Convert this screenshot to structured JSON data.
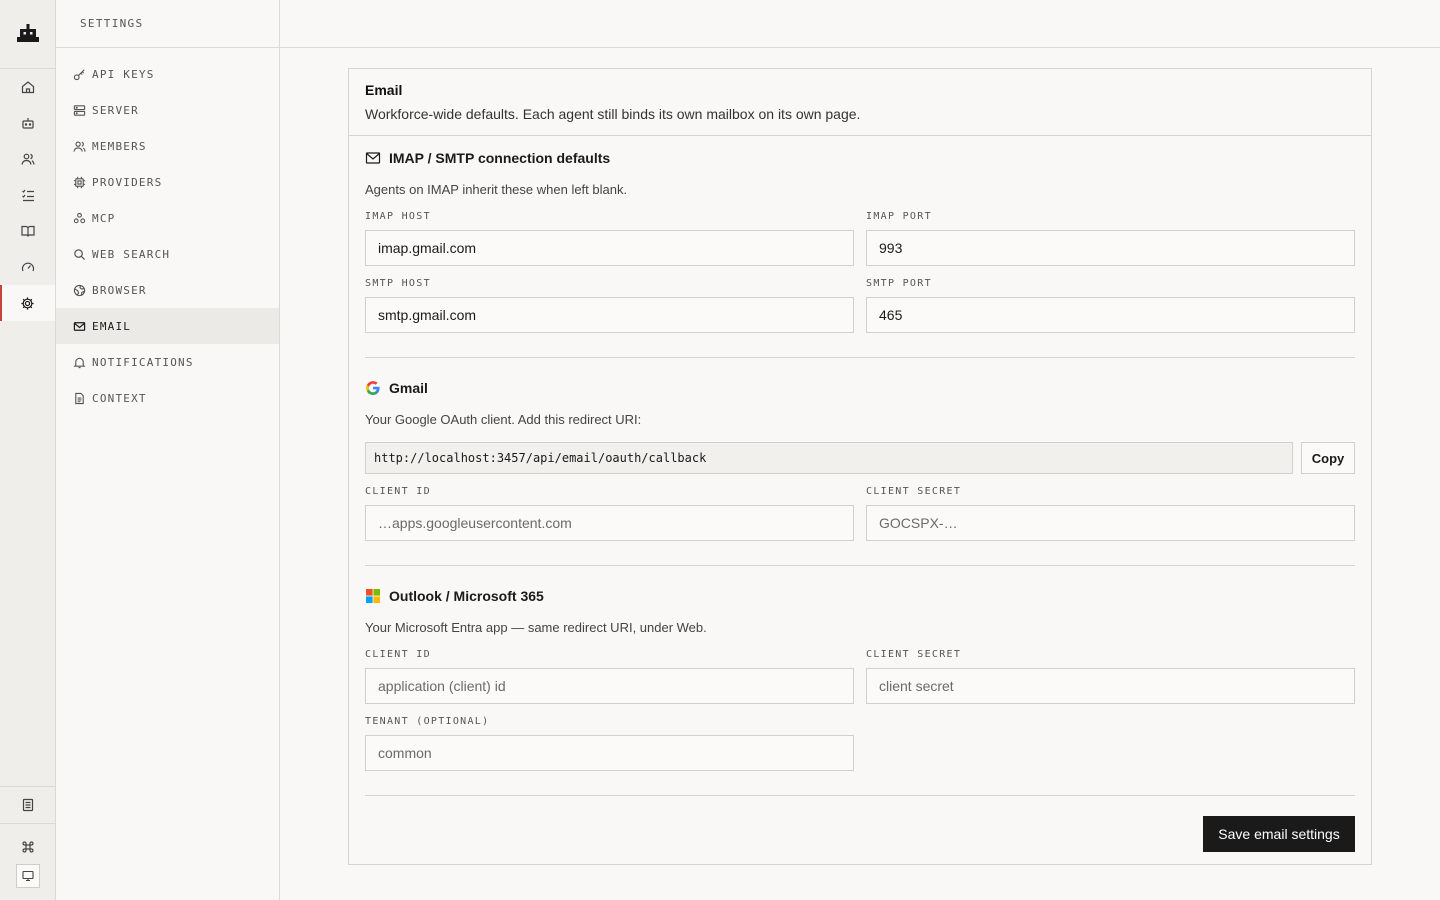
{
  "header": {
    "title": "SETTINGS"
  },
  "settings_nav": [
    {
      "label": "API KEYS",
      "icon": "key-icon"
    },
    {
      "label": "SERVER",
      "icon": "server-icon"
    },
    {
      "label": "MEMBERS",
      "icon": "users-icon"
    },
    {
      "label": "PROVIDERS",
      "icon": "chip-icon"
    },
    {
      "label": "MCP",
      "icon": "mcp-icon"
    },
    {
      "label": "WEB SEARCH",
      "icon": "search-icon"
    },
    {
      "label": "BROWSER",
      "icon": "globe-icon"
    },
    {
      "label": "EMAIL",
      "icon": "mail-icon",
      "active": true
    },
    {
      "label": "NOTIFICATIONS",
      "icon": "bell-icon"
    },
    {
      "label": "CONTEXT",
      "icon": "document-icon"
    }
  ],
  "rail": [
    "home-icon",
    "agent-icon",
    "users-icon",
    "tasks-icon",
    "book-icon",
    "gauge-icon",
    "settings-icon",
    "notes-icon",
    "command-icon",
    "monitor-icon"
  ],
  "card": {
    "title": "Email",
    "description": "Workforce-wide defaults. Each agent still binds its own mailbox on its own page."
  },
  "imap": {
    "title": "IMAP / SMTP connection defaults",
    "note": "Agents on IMAP inherit these when left blank.",
    "imap_host_label": "IMAP HOST",
    "imap_host": "imap.gmail.com",
    "imap_port_label": "IMAP PORT",
    "imap_port": "993",
    "smtp_host_label": "SMTP HOST",
    "smtp_host": "smtp.gmail.com",
    "smtp_port_label": "SMTP PORT",
    "smtp_port": "465"
  },
  "gmail": {
    "title": "Gmail",
    "note": "Your Google OAuth client. Add this redirect URI:",
    "redirect_uri": "http://localhost:3457/api/email/oauth/callback",
    "copy_label": "Copy",
    "client_id_label": "CLIENT ID",
    "client_id_placeholder": "…apps.googleusercontent.com",
    "client_secret_label": "CLIENT SECRET",
    "client_secret_placeholder": "GOCSPX-…"
  },
  "outlook": {
    "title": "Outlook / Microsoft 365",
    "note": "Your Microsoft Entra app — same redirect URI, under Web.",
    "client_id_label": "CLIENT ID",
    "client_id_placeholder": "application (client) id",
    "client_secret_label": "CLIENT SECRET",
    "client_secret_placeholder": "client secret",
    "tenant_label": "TENANT (OPTIONAL)",
    "tenant_placeholder": "common"
  },
  "save_label": "Save email settings",
  "colors": {
    "accent": "#c6443a",
    "primary_button": "#1a1a1a",
    "background": "#f9f8f6"
  }
}
